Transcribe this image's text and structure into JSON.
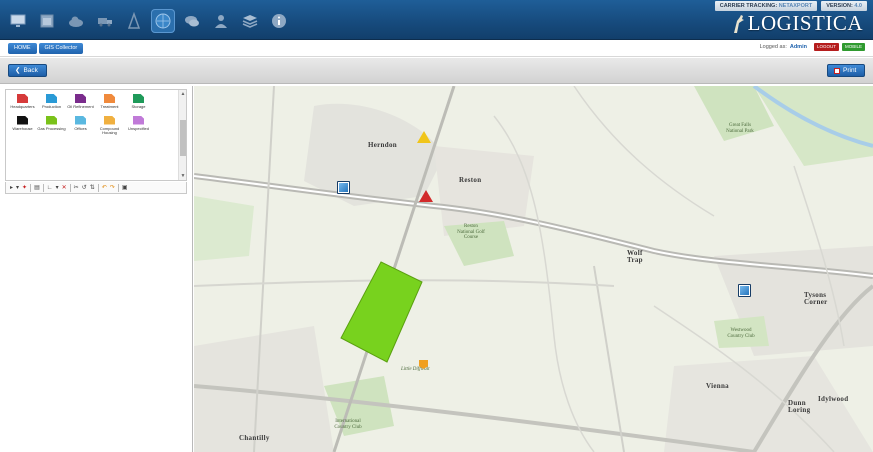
{
  "header": {
    "carrier_tracking_label": "CARRIER TRACKING:",
    "carrier_tracking_value": "NETAXPORT",
    "version_label": "VERSION:",
    "version_value": "4.0",
    "logo_text": "LOGISTICA",
    "toolbar_icons": [
      "monitor-icon",
      "calendar-icon",
      "cloud-icon",
      "truck-icon",
      "tower-icon",
      "globe-icon",
      "chat-icon",
      "user-icon",
      "layers-icon",
      "info-icon"
    ],
    "active_icon": "globe-icon",
    "accent": "#1f5e98"
  },
  "breadcrumb": {
    "items": [
      "HOME",
      "GIS Collector"
    ]
  },
  "login": {
    "label": "Logged as:",
    "user": "Admin",
    "logout": "LOGOUT",
    "mobile": "MOBILE"
  },
  "actions": {
    "back": "Back",
    "print": "Print"
  },
  "palette": {
    "items": [
      {
        "label": "Headquarters",
        "color": "#d63a3a"
      },
      {
        "label": "Production",
        "color": "#2a9ad6"
      },
      {
        "label": "Oil Refinement",
        "color": "#7a2c8c"
      },
      {
        "label": "Treatment",
        "color": "#f08a3c"
      },
      {
        "label": "Storage",
        "color": "#1f9a5a"
      },
      {
        "label": "Warehouse",
        "color": "#111111"
      },
      {
        "label": "Gas Processing",
        "color": "#7ac21a"
      },
      {
        "label": "Offices",
        "color": "#5ab8e0"
      },
      {
        "label": "Compound Housing",
        "color": "#f0b040"
      },
      {
        "label": "Unspecified",
        "color": "#c07ad8"
      }
    ]
  },
  "map": {
    "labels": {
      "herndon": "Herndon",
      "reston": "Reston",
      "wolf_trap": "Wolf Trap",
      "tysons": "Tysons Corner",
      "vienna": "Vienna",
      "dunn_loring": "Dunn Loring",
      "idylwood": "Idylwood",
      "chantilly": "Chantilly",
      "great_falls": "Great Falls National Park",
      "reston_golf": "Reston National Golf Course",
      "westwood": "Westwood Country Club",
      "intl_cc": "International Country Club",
      "little_difficult": "Little Difficult"
    },
    "polygon_color": "#78d21e"
  }
}
